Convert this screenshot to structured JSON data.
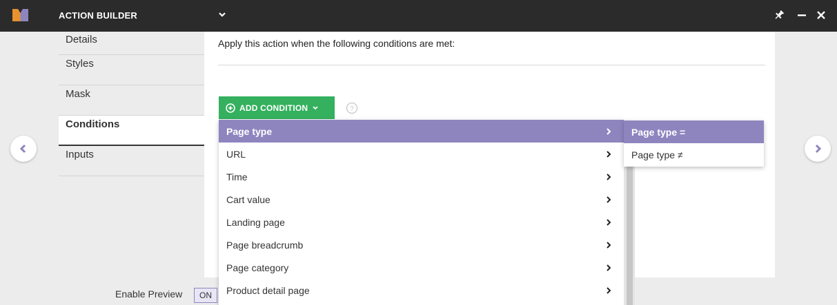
{
  "app": {
    "title": "ACTION BUILDER",
    "brand_color": "#8e85bf",
    "logo_colors": [
      "#8e85bf",
      "#e8912f"
    ]
  },
  "sidebar": {
    "items": [
      {
        "label": "Details",
        "active": false
      },
      {
        "label": "Styles",
        "active": false
      },
      {
        "label": "Mask",
        "active": false
      },
      {
        "label": "Conditions",
        "active": true
      },
      {
        "label": "Inputs",
        "active": false
      }
    ]
  },
  "main": {
    "heading": "Apply this action when the following conditions are met:",
    "add_condition_label": "ADD CONDITION",
    "add_condition_color": "#34b05e"
  },
  "dropdown": {
    "items": [
      {
        "label": "Page type",
        "active": true
      },
      {
        "label": "URL",
        "active": false
      },
      {
        "label": "Time",
        "active": false
      },
      {
        "label": "Cart value",
        "active": false
      },
      {
        "label": "Landing page",
        "active": false
      },
      {
        "label": "Page breadcrumb",
        "active": false
      },
      {
        "label": "Page category",
        "active": false
      },
      {
        "label": "Product detail page",
        "active": false
      }
    ]
  },
  "submenu": {
    "items": [
      {
        "label": "Page type =",
        "active": true
      },
      {
        "label": "Page type ≠",
        "active": false
      }
    ]
  },
  "footer": {
    "preview_label": "Enable Preview",
    "preview_toggle": "ON"
  },
  "icons": {
    "logo": "brand-logo",
    "title_caret": "chevron-down-icon",
    "pin": "pin-icon",
    "minimize": "minimize-icon",
    "close": "close-icon",
    "prev": "chevron-left-icon",
    "next": "chevron-right-icon",
    "add": "plus-circle-icon",
    "help": "help-icon"
  }
}
